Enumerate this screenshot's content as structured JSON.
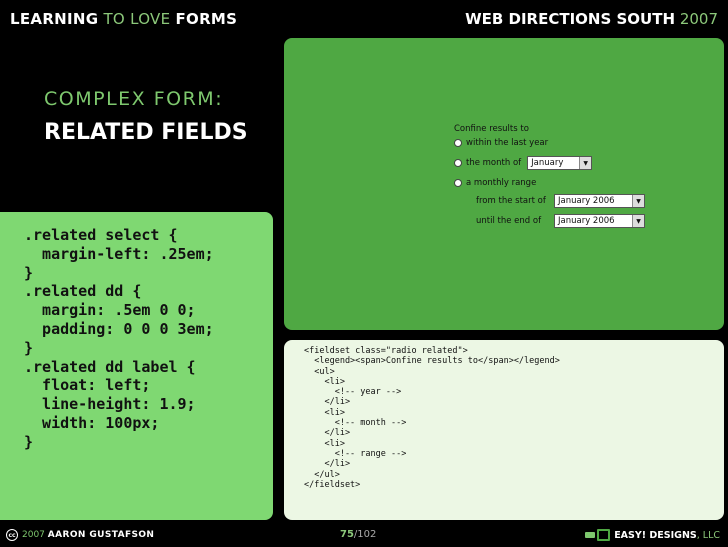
{
  "header": {
    "left_1": "LEARNING",
    "left_2": "TO LOVE",
    "left_3": "FORMS",
    "right_1": "WEB DIRECTIONS SOUTH",
    "right_2": "2007"
  },
  "slide": {
    "title_line1": "COMPLEX FORM:",
    "title_line2": "RELATED FIELDS"
  },
  "css_code": ".related select {\n  margin-left: .25em;\n}\n.related dd {\n  margin: .5em 0 0;\n  padding: 0 0 0 3em;\n}\n.related dd label {\n  float: left;\n  line-height: 1.9;\n  width: 100px;\n}",
  "demo_form": {
    "legend": "Confine results to",
    "option_1": "within the last year",
    "option_2": "the month of",
    "option_2_select": "January",
    "option_3": "a monthly range",
    "from_label": "from the start of",
    "from_select": "January 2006",
    "until_label": "until the end of",
    "until_select": "January 2006"
  },
  "html_code": "<fieldset class=\"radio related\">\n  <legend><span>Confine results to</span></legend>\n  <ul>\n    <li>\n      <!-- year -->\n    </li>\n    <li>\n      <!-- month -->\n    </li>\n    <li>\n      <!-- range -->\n    </li>\n  </ul>\n</fieldset>",
  "footer": {
    "year": "2007",
    "author": "AARON GUSTAFSON",
    "page_current": "75",
    "page_total": "102",
    "company_1": "EASY! DESIGNS",
    "company_2": ", LLC"
  },
  "colors": {
    "background": "#000000",
    "accent_green": "#7ec86e",
    "css_panel": "#7fd872",
    "demo_panel": "#4fa843",
    "html_panel": "#ecf7e4"
  }
}
